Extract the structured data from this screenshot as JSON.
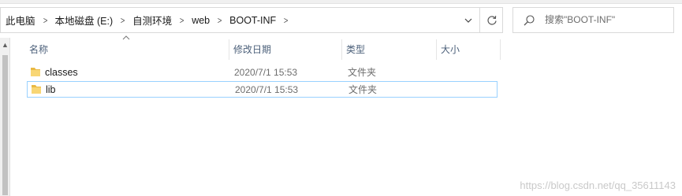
{
  "breadcrumb": {
    "items": [
      "此电脑",
      "本地磁盘 (E:)",
      "自测环境",
      "web",
      "BOOT-INF"
    ],
    "separator": ">"
  },
  "search": {
    "placeholder": "搜索\"BOOT-INF\""
  },
  "columns": {
    "name": "名称",
    "modified": "修改日期",
    "type": "类型",
    "size": "大小"
  },
  "files": [
    {
      "name": "classes",
      "modified": "2020/7/1 15:53",
      "type": "文件夹",
      "selected": false
    },
    {
      "name": "lib",
      "modified": "2020/7/1 15:53",
      "type": "文件夹",
      "selected": true
    }
  ],
  "watermark": "https://blog.csdn.net/qq_35611143",
  "icons": {
    "folder": "folder-icon",
    "refresh": "refresh-icon",
    "search": "search-icon",
    "dropdown": "chevron-down-icon",
    "sort": "sort-ascending-icon"
  },
  "colors": {
    "selection_border": "#99d1ff",
    "folder": "#f0c85a",
    "header_text": "#4c607a"
  }
}
